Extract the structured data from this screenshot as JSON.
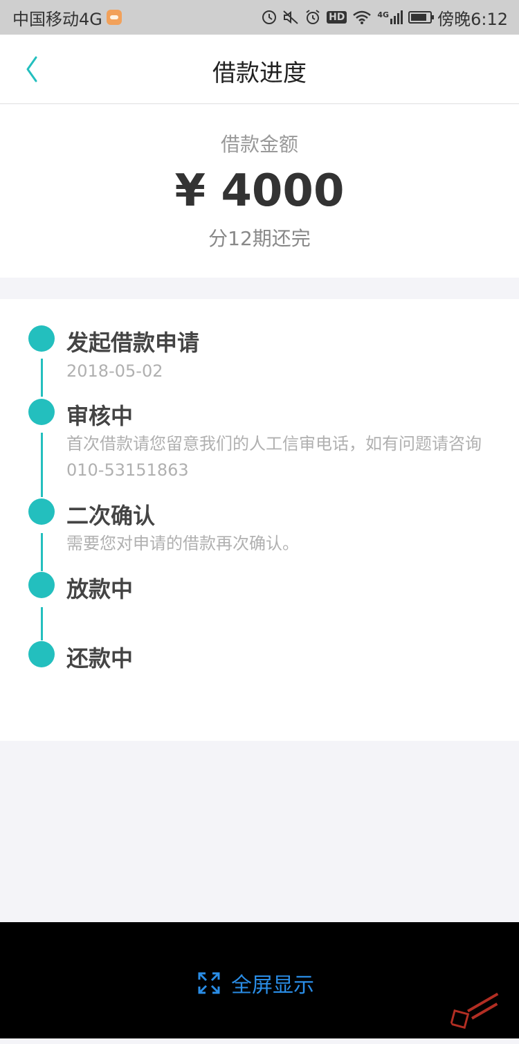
{
  "status_bar": {
    "carrier": "中国移动4G",
    "time": "傍晚6:12",
    "hd_label": "HD",
    "network_label": "4G"
  },
  "nav": {
    "title": "借款进度"
  },
  "amount": {
    "label": "借款金额",
    "value": "¥ 4000",
    "term": "分12期还完"
  },
  "timeline": [
    {
      "title": "发起借款申请",
      "desc": "2018-05-02"
    },
    {
      "title": "审核中",
      "desc": "首次借款请您留意我们的人工信审电话，如有问题请咨询 010-53151863"
    },
    {
      "title": "二次确认",
      "desc": "需要您对申请的借款再次确认。"
    },
    {
      "title": "放款中",
      "desc": ""
    },
    {
      "title": "还款中",
      "desc": ""
    }
  ],
  "bottom": {
    "fullscreen_label": "全屏显示"
  },
  "colors": {
    "accent": "#23bfbe",
    "link_blue": "#2a8de6"
  }
}
